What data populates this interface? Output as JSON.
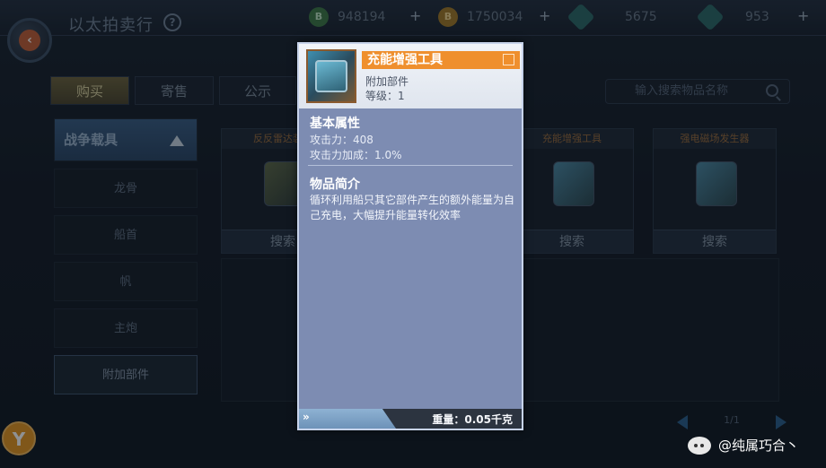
{
  "header": {
    "title": "以太拍卖行",
    "help_label": "?",
    "currencies": [
      {
        "icon": "green-coin-icon",
        "value": "948194"
      },
      {
        "icon": "gold-coin-icon",
        "value": "1750034"
      },
      {
        "icon": "teal-crystal-icon",
        "value": "5675"
      },
      {
        "icon": "teal-gem-icon",
        "value": "953"
      }
    ],
    "plus_label": "+"
  },
  "tabs": [
    {
      "label": "购买",
      "active": true
    },
    {
      "label": "寄售",
      "active": false
    },
    {
      "label": "公示",
      "active": false
    }
  ],
  "search": {
    "placeholder": "输入搜索物品名称"
  },
  "categories": {
    "head": "战争载具",
    "items": [
      "龙骨",
      "船首",
      "帆",
      "主炮",
      "附加部件"
    ],
    "selected": "附加部件"
  },
  "cards": [
    {
      "name": "反反雷达装置",
      "button": "搜索"
    },
    {
      "name": "充能增强工具",
      "button": "搜索"
    },
    {
      "name": "强电磁场发生器",
      "button": "搜索"
    }
  ],
  "pager": {
    "text": "1/1"
  },
  "corner_logo": "Y",
  "watermark": "@纯属巧合丶",
  "popup": {
    "item_name": "充能增强工具",
    "item_type": "附加部件",
    "item_level": "等级：1",
    "basic_title": "基本属性",
    "attributes": [
      "攻击力：408",
      "攻击力加成：1.0%"
    ],
    "intro_title": "物品简介",
    "description": "循环利用船只其它部件产生的额外能量为自己充电，大幅提升能量转化效率",
    "weight": "重量：0.05千克",
    "footer_arrows": "»"
  },
  "colors": {
    "popup_bg": "#7d8cb2",
    "name_bar": "#ef8f2d",
    "active_tab": "#6e6540",
    "category_head": "#3a5e86"
  }
}
